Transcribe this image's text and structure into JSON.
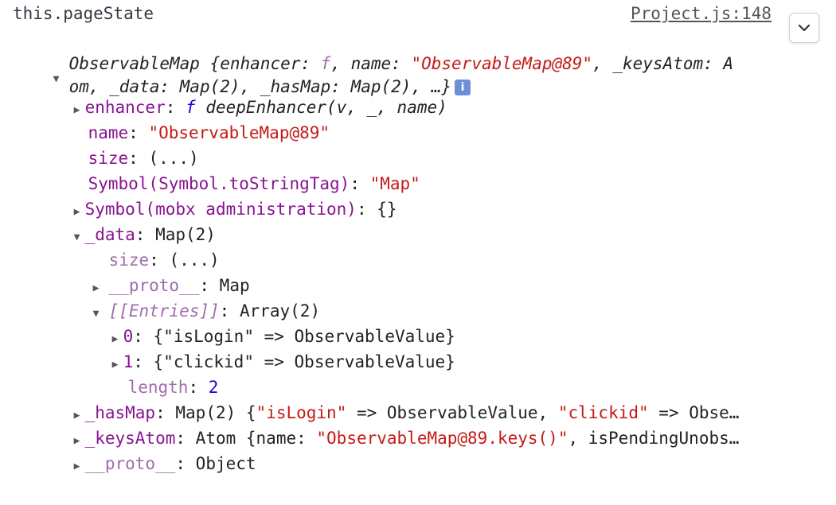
{
  "header": {
    "expression": "this.pageState",
    "source_link": "Project.js:148",
    "menu_icon": "chevron-down-icon"
  },
  "summary": {
    "line1": {
      "class": "ObservableMap",
      "p1": " {enhancer: ",
      "f": "f",
      "p2": ", name: ",
      "name": "\"ObservableMap@89\"",
      "p3": ", _keysAtom: A"
    },
    "line2": {
      "text": "om, _data: Map(2), _hasMap: Map(2), …}",
      "info": "i"
    }
  },
  "rows": {
    "enhancer": {
      "key": "enhancer",
      "sep": ": ",
      "f": "f",
      "val": " deepEnhancer(v, _, name)"
    },
    "name": {
      "key": "name",
      "sep": ": ",
      "val": "\"ObservableMap@89\""
    },
    "size": {
      "key": "size",
      "sep": ": ",
      "val": "(...)"
    },
    "tostringtag": {
      "key": "Symbol(Symbol.toStringTag)",
      "sep": ": ",
      "val": "\"Map\""
    },
    "mobx": {
      "key": "Symbol(mobx administration)",
      "sep": ": ",
      "val": "{}"
    },
    "data": {
      "key": "_data",
      "sep": ": ",
      "val": "Map(2)"
    },
    "data_size": {
      "key": "size",
      "sep": ": ",
      "val": "(...)"
    },
    "data_proto": {
      "key": "__proto__",
      "sep": ": ",
      "val": "Map"
    },
    "entries": {
      "key": "[[Entries]]",
      "sep": ": ",
      "val": "Array(2)"
    },
    "entry0": {
      "key": "0",
      "sep": ": ",
      "val": "{\"isLogin\" => ObservableValue}"
    },
    "entry1": {
      "key": "1",
      "sep": ": ",
      "val": "{\"clickid\" => ObservableValue}"
    },
    "length": {
      "key": "length",
      "sep": ": ",
      "val": "2"
    },
    "hasmap": {
      "key": "_hasMap",
      "sep": ": ",
      "p1": "Map(2) {",
      "s1": "\"isLogin\"",
      "p2": " => ObservableValue, ",
      "s2": "\"clickid\"",
      "p3": " => Obse…"
    },
    "keysatom": {
      "key": "_keysAtom",
      "sep": ": ",
      "p1": "Atom {name: ",
      "s1": "\"ObservableMap@89.keys()\"",
      "p2": ", isPendingUnobs…"
    },
    "proto": {
      "key": "__proto__",
      "sep": ": ",
      "val": "Object"
    }
  },
  "triangles": {
    "collapsed": "▶",
    "expanded": "▼"
  }
}
